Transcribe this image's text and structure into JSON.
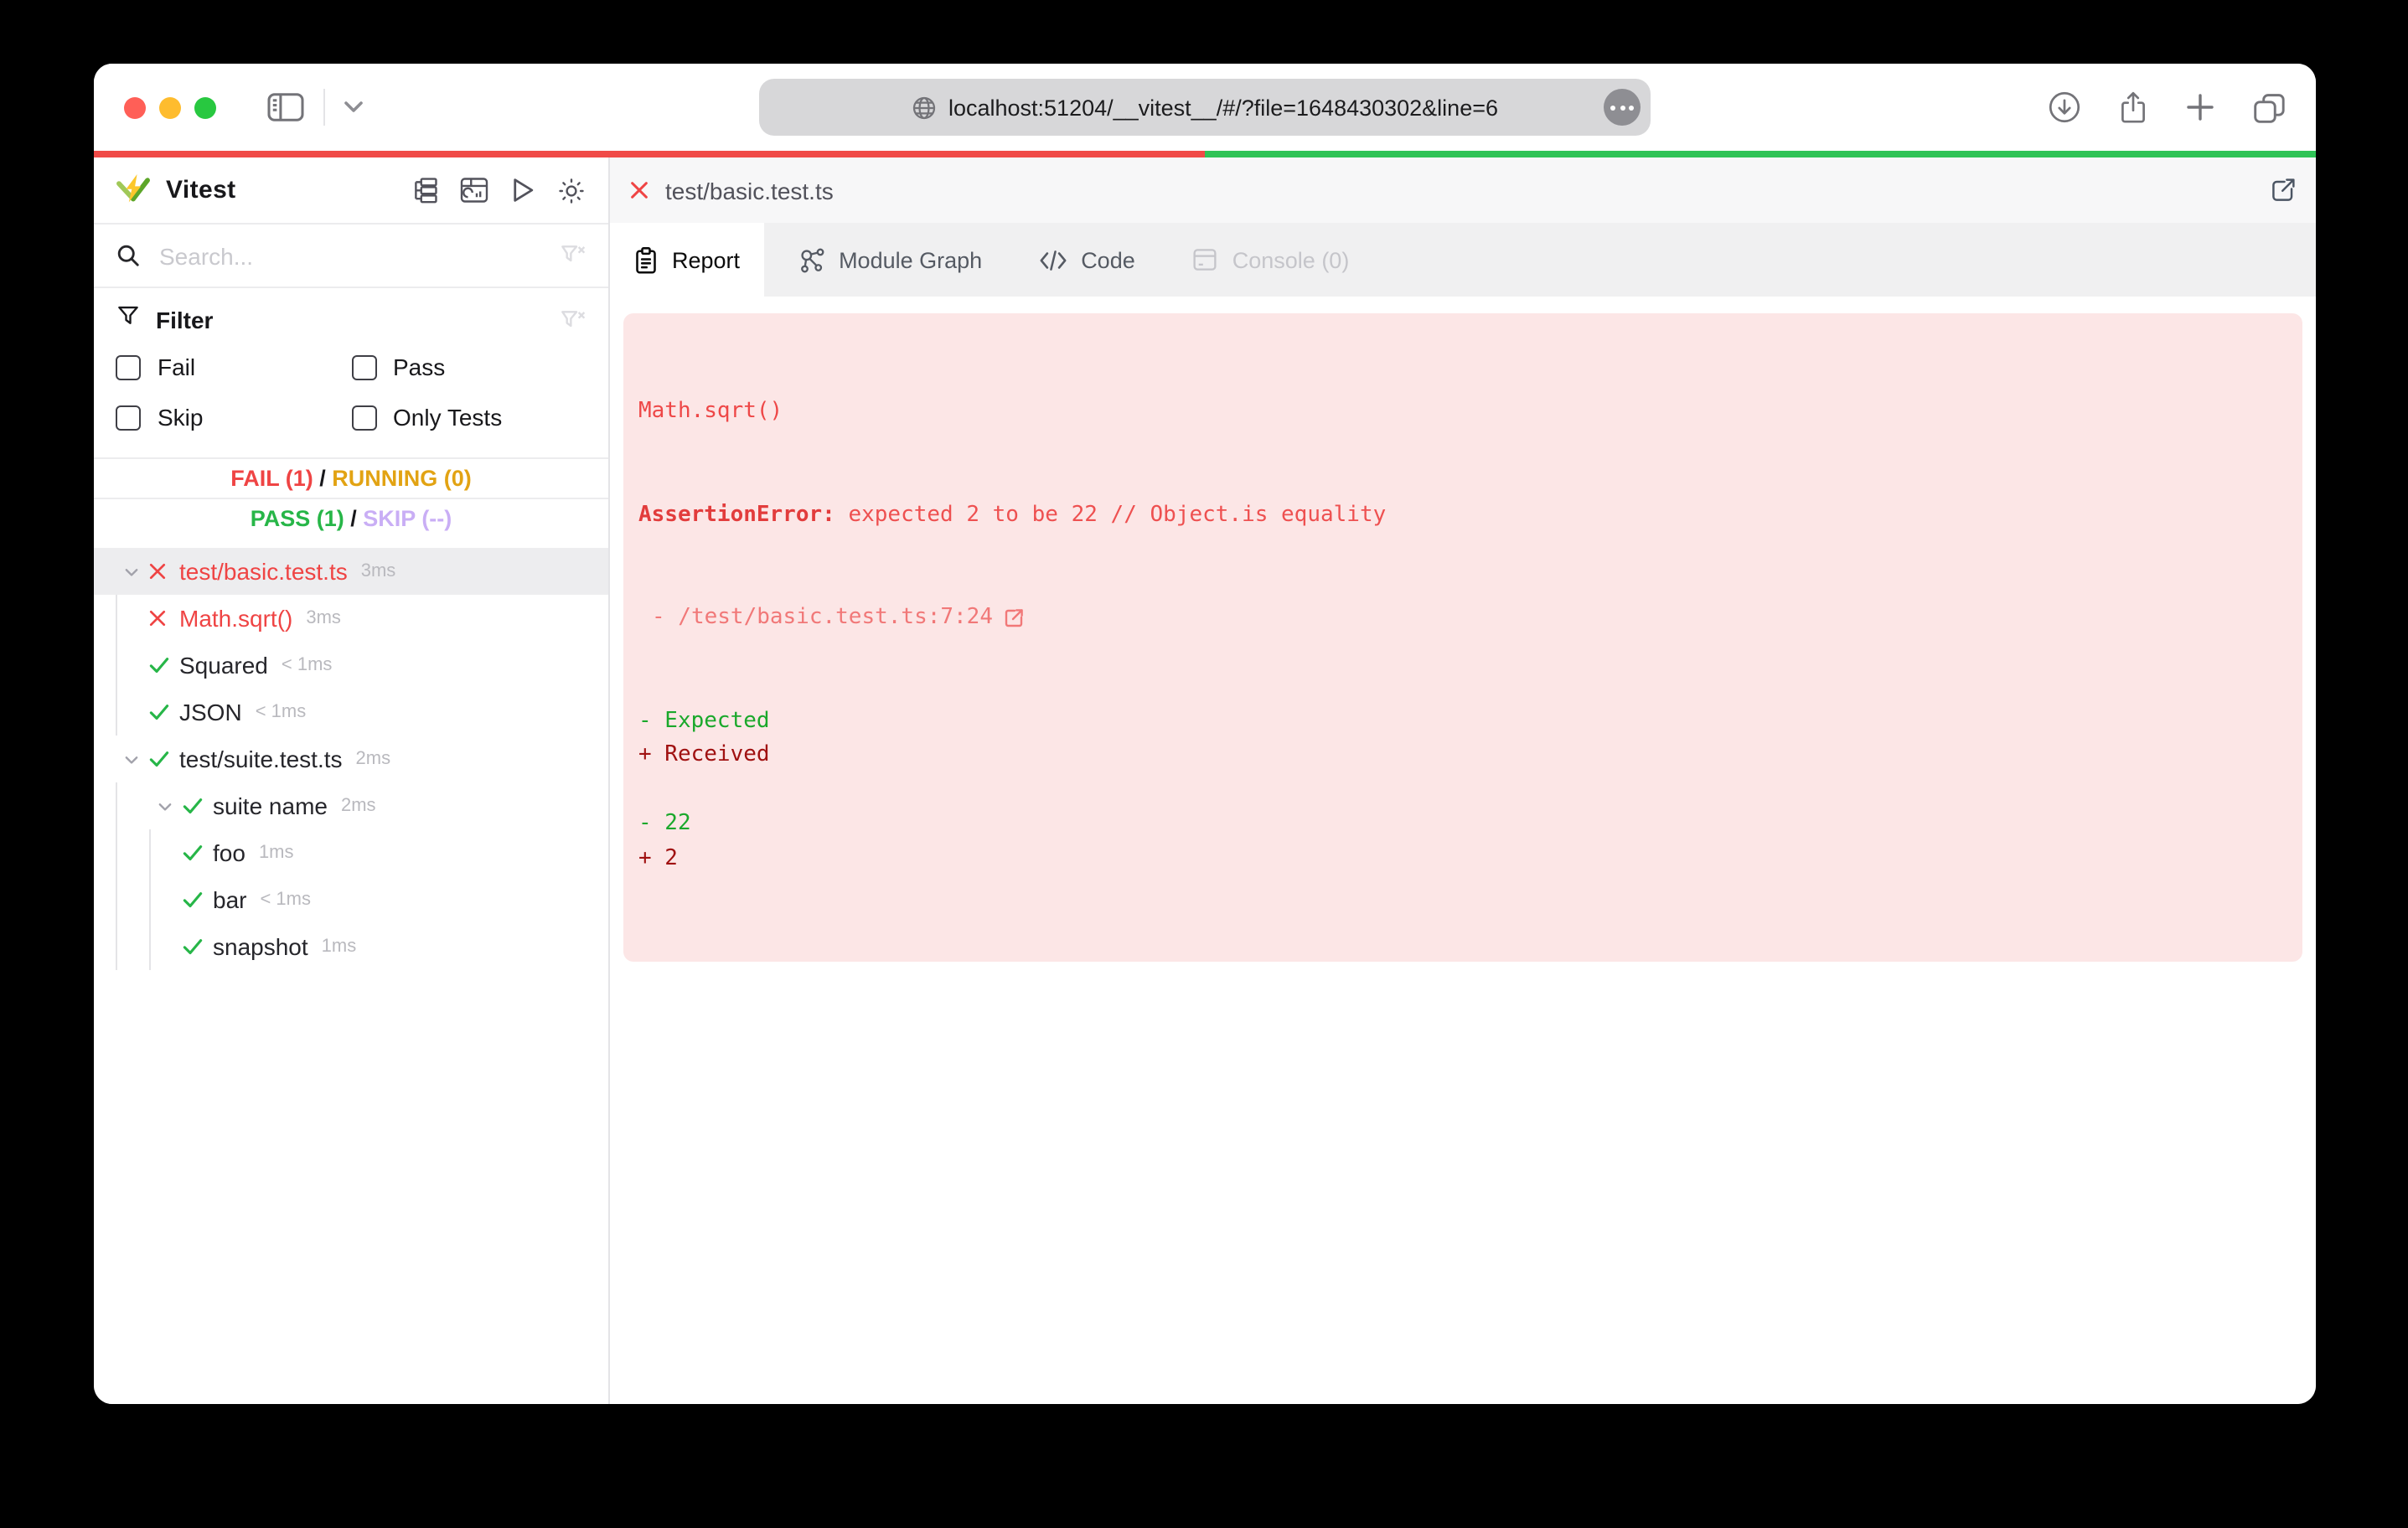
{
  "browser": {
    "traffic_lights": [
      "close",
      "minimize",
      "maximize"
    ],
    "toolbar_icons_left": [
      "sidebar-toggle",
      "chevron-down"
    ],
    "url": "localhost:51204/__vitest__/#/?file=1648430302&line=6",
    "url_icons": [
      "globe",
      "more-options"
    ],
    "toolbar_icons_right": [
      "download",
      "share",
      "new-tab",
      "tab-overview"
    ]
  },
  "progress": {
    "fail_fraction": 0.5,
    "fail_color": "#f04a47",
    "pass_color": "#2fc356"
  },
  "sidebar": {
    "app_title": "Vitest",
    "header_icons": [
      "expand-tree",
      "dashboard",
      "run-all",
      "toggle-theme"
    ],
    "search": {
      "placeholder": "Search...",
      "value": ""
    },
    "filter": {
      "title": "Filter",
      "options": [
        {
          "label": "Fail",
          "checked": false
        },
        {
          "label": "Pass",
          "checked": false
        },
        {
          "label": "Skip",
          "checked": false
        },
        {
          "label": "Only Tests",
          "checked": false
        }
      ]
    },
    "status": {
      "fail": "FAIL (1)",
      "running": "RUNNING (0)",
      "pass": "PASS (1)",
      "skip": "SKIP (--)",
      "separator": " / "
    },
    "colors": {
      "fail": "#ef4444",
      "running": "#e2a313",
      "pass": "#27b648",
      "skip": "#c9aef5"
    },
    "tree": [
      {
        "depth": 0,
        "chevron": true,
        "state": "fail",
        "label": "test/basic.test.ts",
        "duration": "3ms",
        "selected": true
      },
      {
        "depth": 1,
        "chevron": false,
        "state": "fail",
        "label": "Math.sqrt()",
        "duration": "3ms",
        "selected": false
      },
      {
        "depth": 1,
        "chevron": false,
        "state": "pass",
        "label": "Squared",
        "duration": "< 1ms",
        "selected": false
      },
      {
        "depth": 1,
        "chevron": false,
        "state": "pass",
        "label": "JSON",
        "duration": "< 1ms",
        "selected": false
      },
      {
        "depth": 0,
        "chevron": true,
        "state": "pass",
        "label": "test/suite.test.ts",
        "duration": "2ms",
        "selected": false
      },
      {
        "depth": 1,
        "chevron": true,
        "state": "pass",
        "label": "suite name",
        "duration": "2ms",
        "selected": false
      },
      {
        "depth": 2,
        "chevron": false,
        "state": "pass",
        "label": "foo",
        "duration": "1ms",
        "selected": false
      },
      {
        "depth": 2,
        "chevron": false,
        "state": "pass",
        "label": "bar",
        "duration": "< 1ms",
        "selected": false
      },
      {
        "depth": 2,
        "chevron": false,
        "state": "pass",
        "label": "snapshot",
        "duration": "1ms",
        "selected": false
      }
    ]
  },
  "main": {
    "file_header": {
      "status": "fail",
      "title": "test/basic.test.ts",
      "action_icon": "open-in-editor"
    },
    "tabs": [
      {
        "label": "Report",
        "icon": "clipboard",
        "state": "active"
      },
      {
        "label": "Module Graph",
        "icon": "module-graph",
        "state": "normal"
      },
      {
        "label": "Code",
        "icon": "code",
        "state": "normal"
      },
      {
        "label": "Console (0)",
        "icon": "console",
        "state": "disabled"
      }
    ],
    "report": {
      "test_name": "Math.sqrt()",
      "error_name": "AssertionError",
      "error_separator": ": ",
      "error_message": "expected 2 to be 22 // Object.is equality",
      "stack_line": "- /test/basic.test.ts:7:24",
      "diff_lines": [
        {
          "text": "- Expected",
          "color": "green"
        },
        {
          "text": "+ Received",
          "color": "darkred"
        },
        {
          "text": "",
          "color": "plain"
        },
        {
          "text": "- 22",
          "color": "green"
        },
        {
          "text": "+ 2",
          "color": "darkred"
        }
      ]
    }
  }
}
